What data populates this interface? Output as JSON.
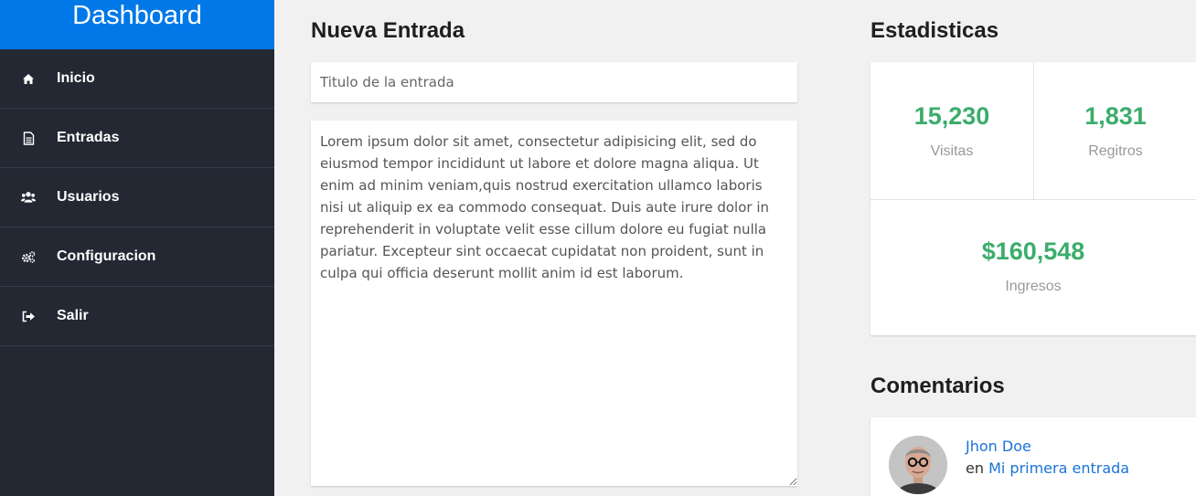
{
  "sidebar": {
    "brand": "Dashboard",
    "items": [
      {
        "label": "Inicio",
        "icon": "home-icon"
      },
      {
        "label": "Entradas",
        "icon": "document-icon"
      },
      {
        "label": "Usuarios",
        "icon": "users-icon"
      },
      {
        "label": "Configuracion",
        "icon": "gears-icon"
      },
      {
        "label": "Salir",
        "icon": "sign-out-icon"
      }
    ]
  },
  "new_entry": {
    "heading": "Nueva Entrada",
    "title_placeholder": "Titulo de la entrada",
    "body_text": "Lorem ipsum dolor sit amet, consectetur adipisicing elit, sed do eiusmod tempor incididunt ut labore et dolore magna aliqua. Ut enim ad minim veniam,quis nostrud exercitation ullamco laboris nisi ut aliquip ex ea commodo consequat. Duis aute irure dolor in reprehenderit in voluptate velit esse cillum dolore eu fugiat nulla pariatur. Excepteur sint occaecat cupidatat non proident, sunt in culpa qui officia deserunt mollit anim id est laborum."
  },
  "stats": {
    "heading": "Estadisticas",
    "visits": {
      "value": "15,230",
      "label": "Visitas"
    },
    "registers": {
      "value": "1,831",
      "label": "Regitros"
    },
    "income": {
      "value": "$160,548",
      "label": "Ingresos"
    }
  },
  "comments": {
    "heading": "Comentarios",
    "items": [
      {
        "author": "Jhon Doe",
        "prefix": "en",
        "post": "Mi primera entrada"
      }
    ]
  },
  "colors": {
    "brand": "#0078e7",
    "sidebar": "#232833",
    "stat_value": "#3bad6b",
    "link": "#1a73d8"
  }
}
